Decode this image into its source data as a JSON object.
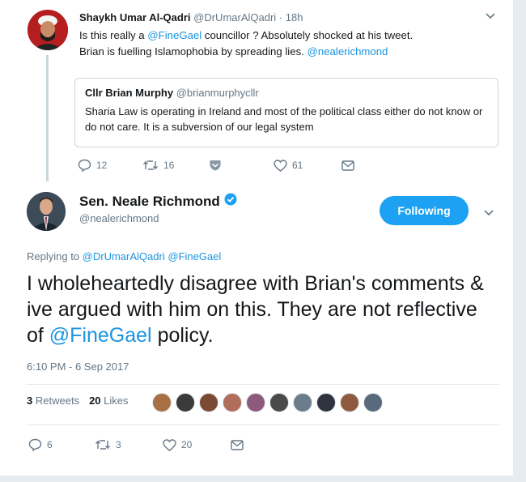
{
  "colors": {
    "accent": "#1da1f2",
    "link": "#1b95e0",
    "muted": "#657786",
    "text": "#14171a"
  },
  "tweet1": {
    "author_name": "Shaykh Umar Al-Qadri",
    "author_handle": "@DrUmarAlQadri",
    "time_separator": " · ",
    "time": "18h",
    "text_part1": "Is this really a ",
    "mention1": "@FineGael",
    "text_part2": " councillor ? Absolutely shocked at his tweet. Brian is fuelling Islamophobia by spreading lies. ",
    "mention2": "@nealerichmond",
    "quote": {
      "name": "Cllr Brian Murphy",
      "handle": "@brianmurphycllr",
      "text": "Sharia Law is operating in Ireland and most of the political class either do not know or do not care. It is a subversion of our legal system"
    },
    "actions": {
      "replies": "12",
      "retweets": "16",
      "likes": "61"
    },
    "icons": [
      "reply-icon",
      "retweet-icon",
      "save-icon",
      "like-icon",
      "message-icon",
      "chevron-down-icon"
    ]
  },
  "tweet2": {
    "author_name": "Sen. Neale Richmond",
    "author_handle": "@nealerichmond",
    "follow_label": "Following",
    "replying_label": "Replying to ",
    "replying_to1": "@DrUmarAlQadri",
    "replying_to2": "@FineGael",
    "text_part1": "I wholeheartedly disagree with Brian's comments & ive argued with him on this. They are not reflective of ",
    "mention": "@FineGael",
    "text_part2": " policy.",
    "timestamp": "6:10 PM - 6 Sep 2017",
    "retweets_count": "3",
    "retweets_label": "Retweets",
    "likes_count": "20",
    "likes_label": "Likes",
    "liker_colors": [
      "#a87044",
      "#3b3b3b",
      "#7a4a32",
      "#b06d5a",
      "#8c5a7a",
      "#4a4a4a",
      "#6b7d8a",
      "#2f3440",
      "#8e5b3e",
      "#5a6a7d"
    ],
    "actions": {
      "replies": "6",
      "retweets": "3",
      "likes": "20"
    },
    "icons": [
      "verified-badge-icon",
      "reply-icon",
      "retweet-icon",
      "like-icon",
      "message-icon",
      "chevron-down-icon"
    ]
  }
}
